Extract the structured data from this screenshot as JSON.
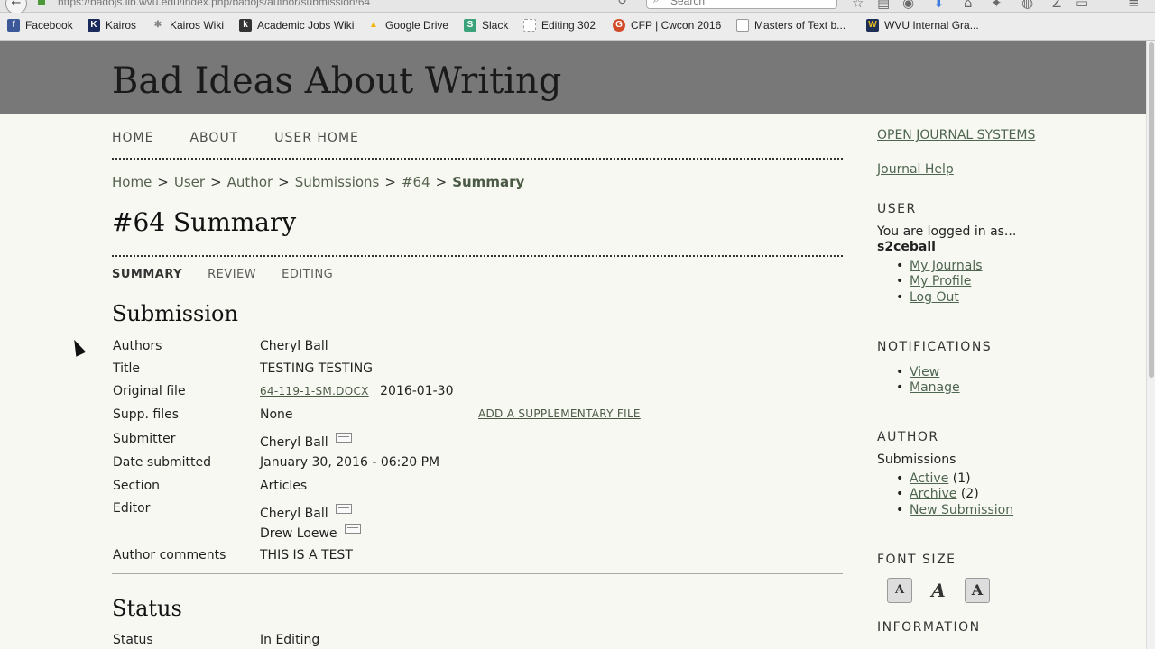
{
  "browser": {
    "url": "https://badojs.lib.wvu.edu/index.php/badojs/author/submission/64",
    "search_placeholder": "Search"
  },
  "bookmarks": [
    {
      "label": "Facebook",
      "icon": "facebook-icon",
      "color": "#3b5998",
      "glyph": "f"
    },
    {
      "label": "Kairos",
      "icon": "kairos-icon",
      "color": "#1b2a5c",
      "glyph": "K"
    },
    {
      "label": "Kairos Wiki",
      "icon": "kairos-wiki-icon",
      "color": "#888888",
      "glyph": "✱"
    },
    {
      "label": "Academic Jobs Wiki",
      "icon": "academic-jobs-icon",
      "color": "#333333",
      "glyph": "k"
    },
    {
      "label": "Google Drive",
      "icon": "google-drive-icon",
      "color": "#f4b400",
      "glyph": "▲"
    },
    {
      "label": "Slack",
      "icon": "slack-icon",
      "color": "#3aa37c",
      "glyph": "S"
    },
    {
      "label": "Editing 302",
      "icon": "page-icon",
      "color": "#bbbbbb",
      "glyph": ""
    },
    {
      "label": "CFP | Cwcon 2016",
      "icon": "cfp-icon",
      "color": "#d24b2a",
      "glyph": "G"
    },
    {
      "label": "Masters of Text b...",
      "icon": "page-icon",
      "color": "#bbbbbb",
      "glyph": ""
    },
    {
      "label": "WVU Internal Gra...",
      "icon": "wvu-icon",
      "color": "#e5b823",
      "glyph": "W"
    }
  ],
  "site": {
    "title": "Bad Ideas About Writing"
  },
  "nav": {
    "home": "HOME",
    "about": "ABOUT",
    "user_home": "USER HOME"
  },
  "breadcrumb": {
    "home": "Home",
    "user": "User",
    "author": "Author",
    "submissions": "Submissions",
    "number": "#64",
    "current": "Summary",
    "sep": ">"
  },
  "page_title": "#64 Summary",
  "tabs": {
    "summary": "SUMMARY",
    "review": "REVIEW",
    "editing": "EDITING"
  },
  "submission": {
    "heading": "Submission",
    "authors_label": "Authors",
    "authors": "Cheryl Ball",
    "title_label": "Title",
    "title": "TESTING TESTING",
    "original_file_label": "Original file",
    "original_file": "64-119-1-SM.DOCX",
    "original_file_date": "2016-01-30",
    "supp_files_label": "Supp. files",
    "supp_files": "None",
    "add_supp_file": "ADD A SUPPLEMENTARY FILE",
    "submitter_label": "Submitter",
    "submitter": "Cheryl Ball",
    "date_label": "Date submitted",
    "date": "January 30, 2016 - 06:20 PM",
    "section_label": "Section",
    "section": "Articles",
    "editor_label": "Editor",
    "editor_1": "Cheryl Ball",
    "editor_2": "Drew Loewe",
    "comments_label": "Author comments",
    "comments": "THIS IS A TEST"
  },
  "status": {
    "heading": "Status",
    "status_label": "Status",
    "status": "In Editing"
  },
  "sidebar": {
    "ojs": "OPEN JOURNAL SYSTEMS",
    "journal_help": "Journal Help",
    "user_heading": "USER",
    "logged_in_as": "You are logged in as...",
    "username": "s2ceball",
    "my_journals": "My Journals",
    "my_profile": "My Profile",
    "log_out": "Log Out",
    "notifications_heading": "NOTIFICATIONS",
    "view": "View",
    "manage": "Manage",
    "author_heading": "AUTHOR",
    "submissions": "Submissions",
    "active": "Active",
    "active_count": "(1)",
    "archive": "Archive",
    "archive_count": "(2)",
    "new_submission": "New Submission",
    "font_size_heading": "FONT SIZE",
    "font_small": "A",
    "font_medium": "A",
    "font_large": "A",
    "information_heading": "INFORMATION"
  }
}
